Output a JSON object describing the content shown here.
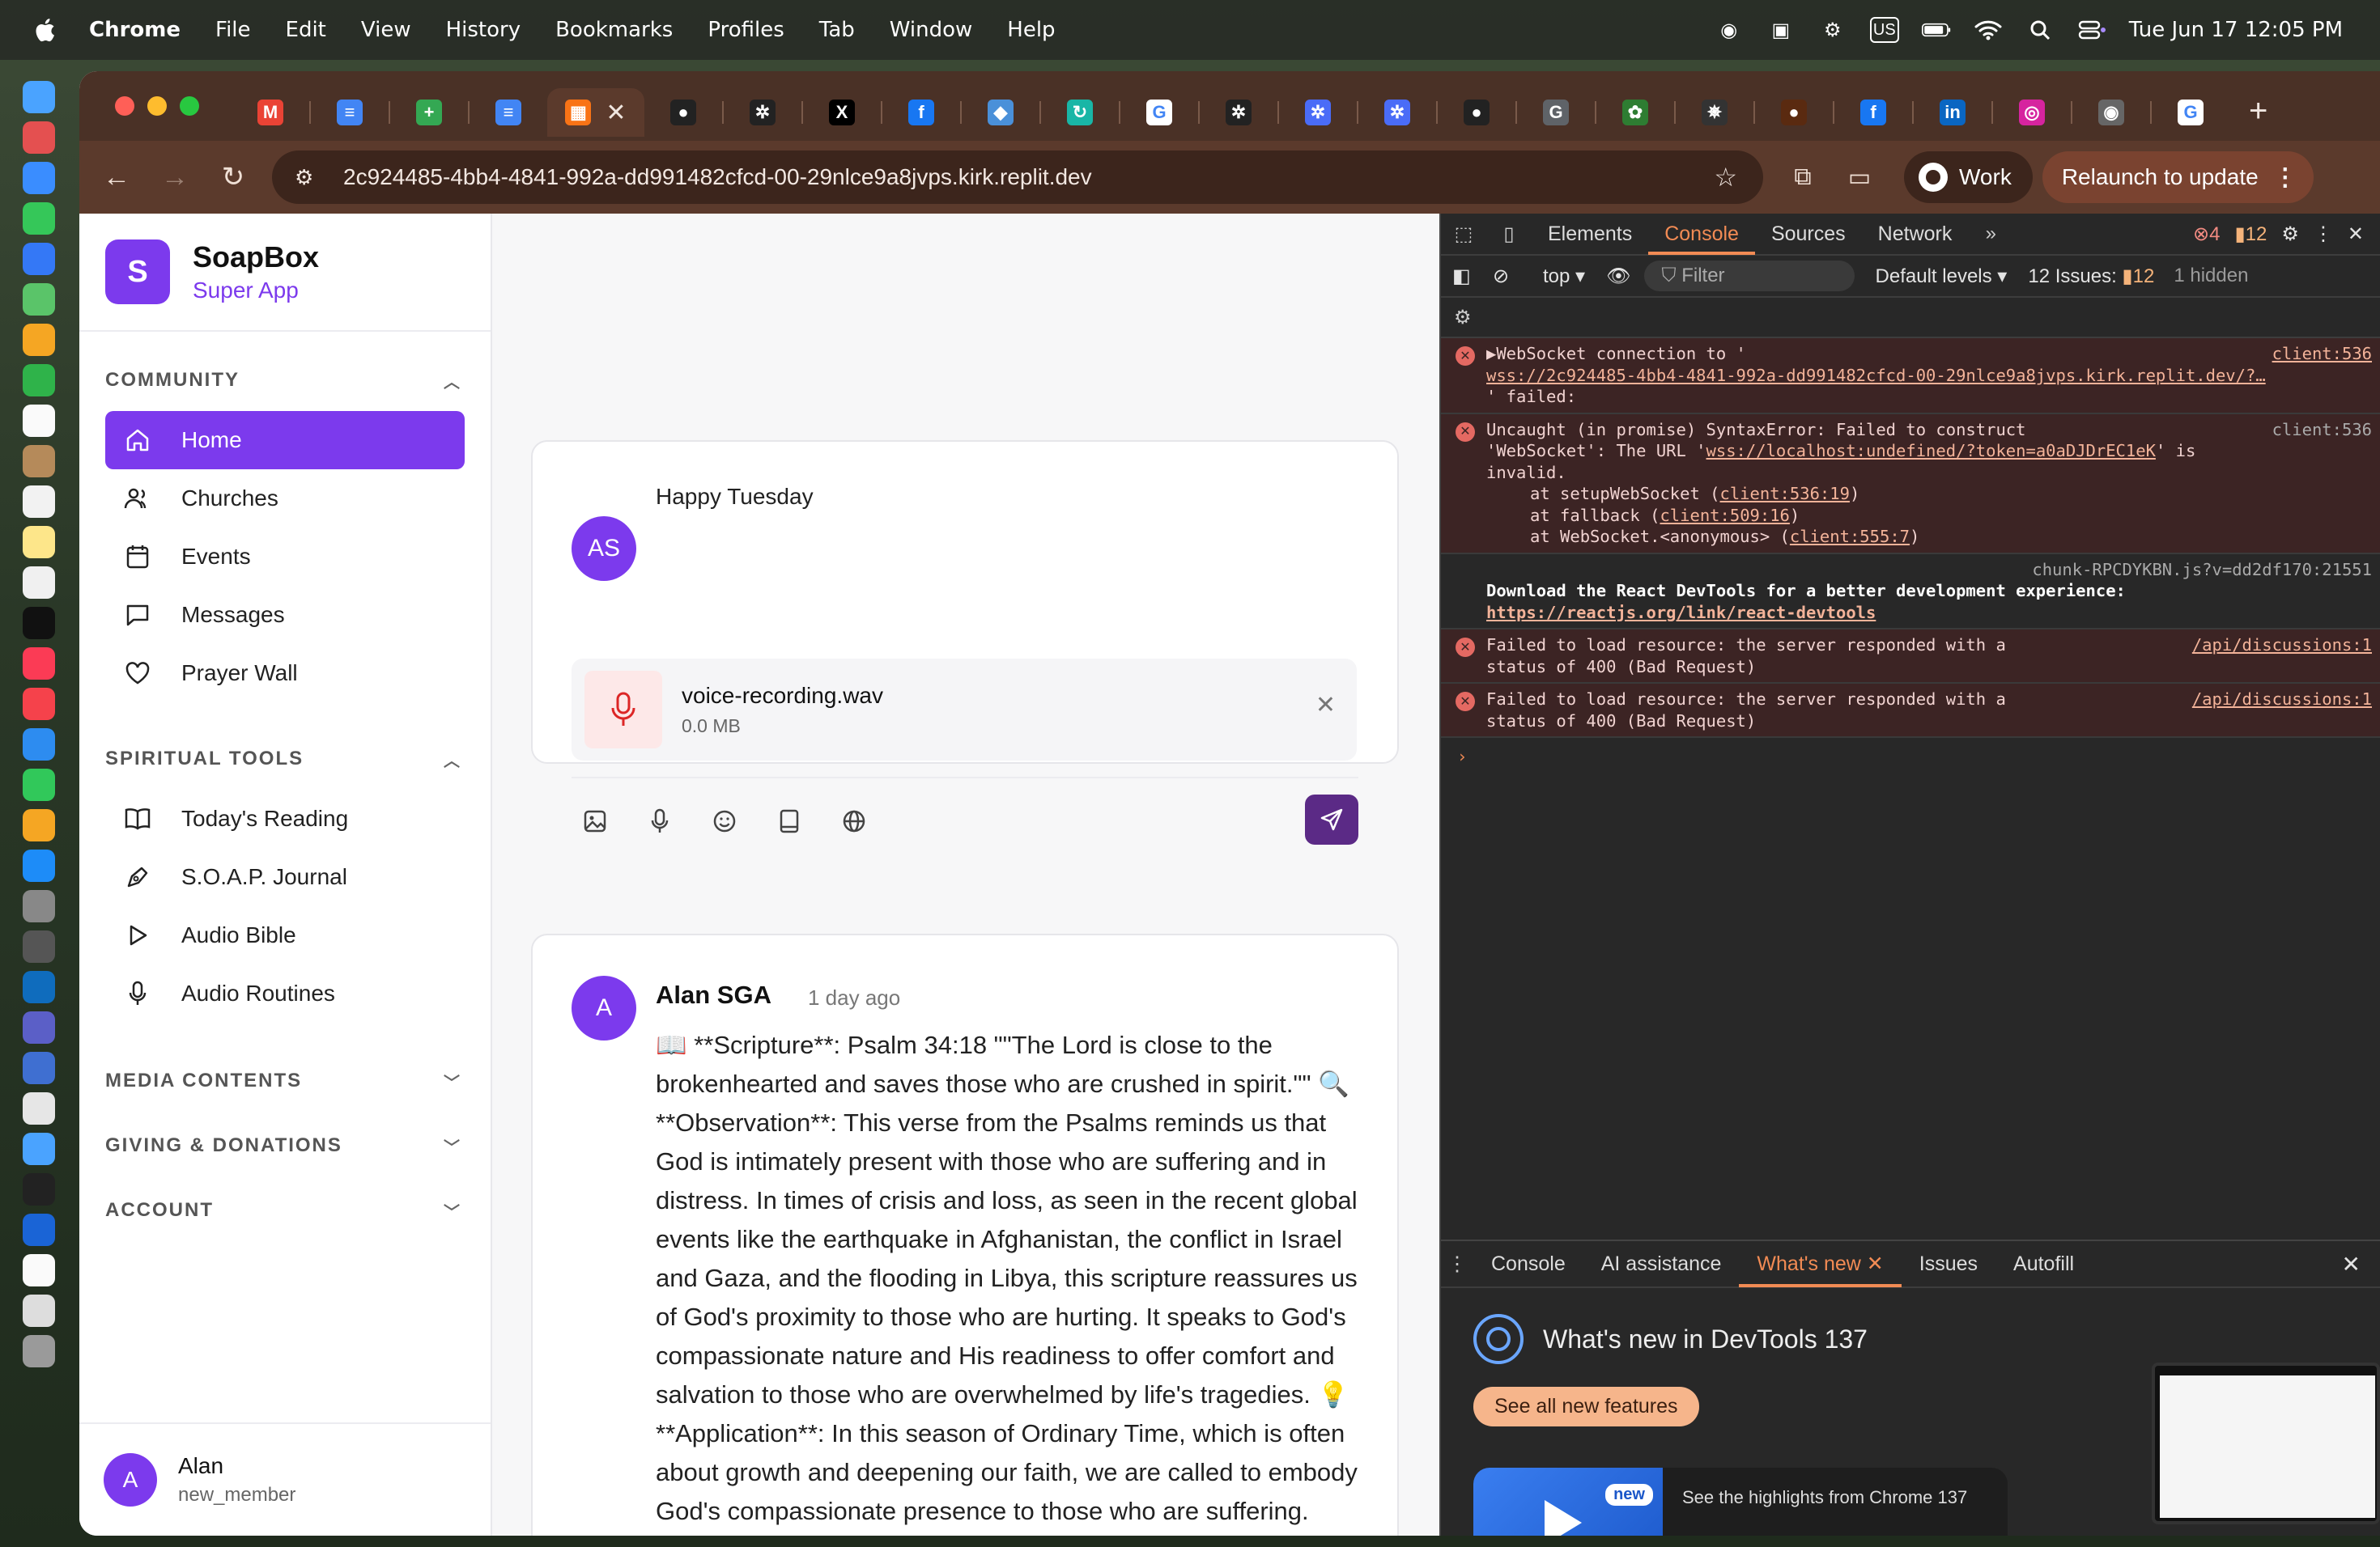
{
  "menubar": {
    "app": "Chrome",
    "items": [
      "File",
      "Edit",
      "View",
      "History",
      "Bookmarks",
      "Profiles",
      "Tab",
      "Window",
      "Help"
    ],
    "ime": "US",
    "clock": "Tue Jun 17  12:05 PM"
  },
  "browser": {
    "url": "2c924485-4bb4-4841-992a-dd991482cfcd-00-29nlce9a8jvps.kirk.replit.dev",
    "profile": "Work",
    "relaunch": "Relaunch to update",
    "tabs": [
      {
        "icon": "gmail-icon",
        "color": "#ea4335",
        "glyph": "M"
      },
      {
        "icon": "google-docs-icon",
        "color": "#4285f4",
        "glyph": "≡"
      },
      {
        "icon": "google-sheets-icon",
        "color": "#34a853",
        "glyph": "+"
      },
      {
        "icon": "google-docs-icon",
        "color": "#4285f4",
        "glyph": "≡"
      },
      {
        "icon": "app-grid-icon",
        "color": "#f97316",
        "glyph": "▦"
      },
      {
        "icon": "github-icon",
        "color": "#222222",
        "glyph": "●"
      },
      {
        "icon": "openai-icon",
        "color": "#222222",
        "glyph": "✲"
      },
      {
        "icon": "x-icon",
        "color": "#000000",
        "glyph": "X"
      },
      {
        "icon": "facebook-icon",
        "color": "#1877f2",
        "glyph": "f"
      },
      {
        "icon": "puzzle-icon",
        "color": "#4a90d9",
        "glyph": "◆"
      },
      {
        "icon": "loop-icon",
        "color": "#19b6a6",
        "glyph": "↻"
      },
      {
        "icon": "google-icon",
        "color": "#ffffff",
        "glyph": "G"
      },
      {
        "icon": "openai-icon",
        "color": "#222222",
        "glyph": "✲"
      },
      {
        "icon": "openai-icon",
        "color": "#4a6cf7",
        "glyph": "✲"
      },
      {
        "icon": "openai-icon",
        "color": "#4a6cf7",
        "glyph": "✲"
      },
      {
        "icon": "github-icon",
        "color": "#222222",
        "glyph": "●"
      },
      {
        "icon": "google-icon",
        "color": "#5f6368",
        "glyph": "G"
      },
      {
        "icon": "leaf-icon",
        "color": "#2e7d32",
        "glyph": "✿"
      },
      {
        "icon": "crest-icon",
        "color": "#333333",
        "glyph": "✵"
      },
      {
        "icon": "circle-icon",
        "color": "#5a2a10",
        "glyph": "●"
      },
      {
        "icon": "facebook-icon",
        "color": "#1877f2",
        "glyph": "f"
      },
      {
        "icon": "linkedin-icon",
        "color": "#0a66c2",
        "glyph": "in"
      },
      {
        "icon": "instagram-icon",
        "color": "#d6249f",
        "glyph": "◎"
      },
      {
        "icon": "chatgpt-icon",
        "color": "#666666",
        "glyph": "◉"
      },
      {
        "icon": "google-icon",
        "color": "#ffffff",
        "glyph": "G"
      }
    ]
  },
  "app": {
    "brand": {
      "logo": "S",
      "name": "SoapBox",
      "subtitle": "Super App"
    },
    "sections": {
      "community": "COMMUNITY",
      "spiritual": "SPIRITUAL TOOLS",
      "media": "MEDIA CONTENTS",
      "giving": "GIVING & DONATIONS",
      "account": "ACCOUNT"
    },
    "community_items": [
      {
        "label": "Home",
        "icon": "home-icon"
      },
      {
        "label": "Churches",
        "icon": "users-icon"
      },
      {
        "label": "Events",
        "icon": "calendar-icon"
      },
      {
        "label": "Messages",
        "icon": "message-icon"
      },
      {
        "label": "Prayer Wall",
        "icon": "heart-icon"
      }
    ],
    "spiritual_items": [
      {
        "label": "Today's Reading",
        "icon": "book-open-icon"
      },
      {
        "label": "S.O.A.P. Journal",
        "icon": "pen-icon"
      },
      {
        "label": "Audio Bible",
        "icon": "play-icon"
      },
      {
        "label": "Audio Routines",
        "icon": "mic-icon"
      }
    ],
    "user": {
      "initial": "A",
      "name": "Alan",
      "role": "new_member"
    },
    "composer": {
      "avatar": "AS",
      "text": "Happy Tuesday",
      "attachment": {
        "name": "voice-recording.wav",
        "size": "0.0 MB"
      }
    },
    "post": {
      "avatar": "A",
      "author": "Alan SGA",
      "time": "1 day ago",
      "body": "📖 **Scripture**: Psalm 34:18 \"\"The Lord is close to the brokenhearted and saves those who are crushed in spirit.\"\" 🔍 **Observation**: This verse from the Psalms reminds us that God is intimately present with those who are suffering and in distress. In times of crisis and loss, as seen in the recent global events like the earthquake in Afghanistan, the conflict in Israel and Gaza, and the flooding in Libya, this scripture reassures us of God's proximity to those who are hurting. It speaks to God's compassionate nature and His readiness to offer comfort and salvation to those who are overwhelmed by life's tragedies. 💡 **Application**: In this season of Ordinary Time, which is often about growth and deepening our faith, we are called to embody God's compassionate presence to those who are suffering. Practically, this means offering our resources, prayers, and"
    }
  },
  "devtools": {
    "tabs": [
      "Elements",
      "Console",
      "Sources",
      "Network"
    ],
    "active_tab": "Console",
    "error_count": "4",
    "warn_count": "12",
    "context": "top ▾",
    "filter_placeholder": "Filter",
    "levels": "Default levels ▾",
    "issues_label": "12 Issues:",
    "issues_count": "12",
    "hidden": "1 hidden",
    "logs": {
      "ws_msg": "▶WebSocket connection to '",
      "ws_url": "wss://2c924485-4bb4-4841-992a-dd991482cfcd-00-29nlce9a8jvps.kirk.replit.dev/?…",
      "ws_tail": "' failed:",
      "ws_src": "client:536",
      "syn_line1": "Uncaught (in promise) SyntaxError: Failed to construct",
      "syn_line2a": "'WebSocket': The URL '",
      "syn_url": "wss://localhost:undefined/?token=a0aDJDrEC1eK",
      "syn_line2b": "' is",
      "syn_line3": "invalid.",
      "syn_src": "client:536",
      "stack1": "at setupWebSocket (",
      "stack1_link": "client:536:19",
      "stack2": "at fallback (",
      "stack2_link": "client:509:16",
      "stack3": "at WebSocket.<anonymous> (",
      "stack3_link": "client:555:7",
      "chunk_src": "chunk-RPCDYKBN.js?v=dd2df170:21551",
      "react_msg": "Download the React DevTools for a better development experience:",
      "react_link": "https://reactjs.org/link/react-devtools",
      "fail_line1": "Failed to load resource: the server responded with a",
      "fail_line2": "status of 400 (Bad Request)",
      "fail_src": "/api/discussions:1"
    },
    "drawer": {
      "tabs": [
        "Console",
        "AI assistance",
        "What's new",
        "Issues",
        "Autofill"
      ],
      "active": "What's new",
      "title": "What's new in DevTools 137",
      "button": "See all new features",
      "badge": "new",
      "highlight": "See the highlights from Chrome 137"
    }
  },
  "colors": {
    "accent": "#7c3aed",
    "devtools_accent": "#f28b54",
    "error": "#e46962"
  }
}
